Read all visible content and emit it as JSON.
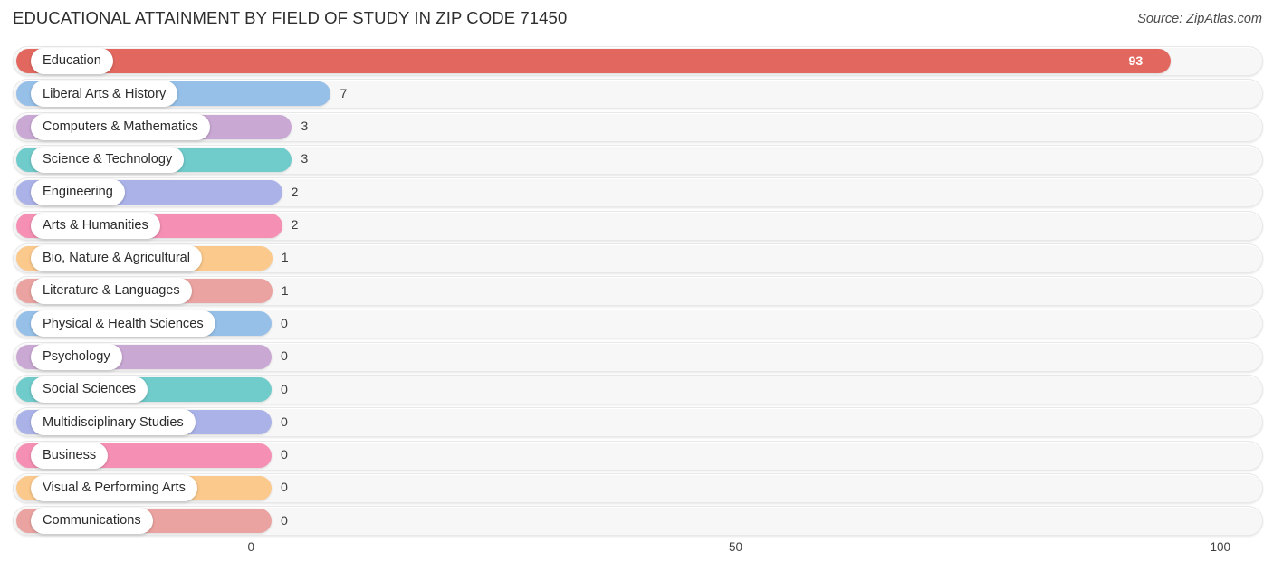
{
  "header": {
    "title": "EDUCATIONAL ATTAINMENT BY FIELD OF STUDY IN ZIP CODE 71450",
    "source": "Source: ZipAtlas.com"
  },
  "chart_data": {
    "type": "bar",
    "orientation": "horizontal",
    "title": "EDUCATIONAL ATTAINMENT BY FIELD OF STUDY IN ZIP CODE 71450",
    "source": "Source: ZipAtlas.com",
    "xlabel": "",
    "ylabel": "",
    "xlim": [
      0,
      100
    ],
    "xticks": [
      "0",
      "50",
      "100"
    ],
    "xtick_values": [
      0,
      50,
      100
    ],
    "grid": true,
    "legend": "none",
    "categories": [
      "Education",
      "Liberal Arts & History",
      "Computers & Mathematics",
      "Science & Technology",
      "Engineering",
      "Arts & Humanities",
      "Bio, Nature & Agricultural",
      "Literature & Languages",
      "Physical & Health Sciences",
      "Psychology",
      "Social Sciences",
      "Multidisciplinary Studies",
      "Business",
      "Visual & Performing Arts",
      "Communications"
    ],
    "values": [
      93,
      7,
      3,
      3,
      2,
      2,
      1,
      1,
      0,
      0,
      0,
      0,
      0,
      0,
      0
    ],
    "value_labels": [
      "93",
      "7",
      "3",
      "3",
      "2",
      "2",
      "1",
      "1",
      "0",
      "0",
      "0",
      "0",
      "0",
      "0",
      "0"
    ],
    "colors": [
      "#e2685f",
      "#96c0e8",
      "#c9a8d4",
      "#70cbcb",
      "#aab2e8",
      "#f590b4",
      "#fbc98b",
      "#eaa3a0",
      "#96c0e8",
      "#c9a8d4",
      "#70cbcb",
      "#aab2e8",
      "#f590b4",
      "#fbc98b",
      "#eaa3a0"
    ]
  }
}
